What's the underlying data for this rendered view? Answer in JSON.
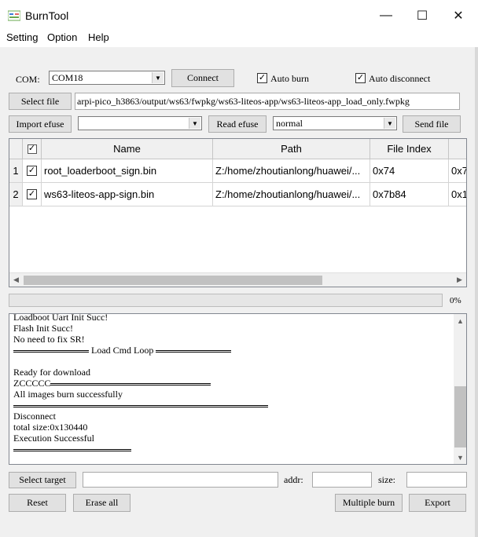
{
  "window": {
    "title": "BurnTool",
    "min_glyph": "—",
    "max_glyph": "☐",
    "close_glyph": "✕"
  },
  "menu": [
    "Setting",
    "Option",
    "Help"
  ],
  "connection": {
    "com_label": "COM:",
    "com_value": "COM18",
    "connect_label": "Connect",
    "auto_burn_label": "Auto burn",
    "auto_burn_checked": true,
    "auto_disconnect_label": "Auto disconnect",
    "auto_disconnect_checked": true
  },
  "file": {
    "select_label": "Select file",
    "path": "arpi-pico_h3863/output/ws63/fwpkg/ws63-liteos-app/ws63-liteos-app_load_only.fwpkg"
  },
  "efuse": {
    "import_label": "Import efuse",
    "import_value": "",
    "read_label": "Read efuse",
    "mode_value": "normal",
    "send_label": "Send file"
  },
  "table": {
    "columns": [
      "",
      "Name",
      "Path",
      "File Index",
      ""
    ],
    "rows": [
      {
        "num": "1",
        "checked": true,
        "name": "root_loaderboot_sign.bin",
        "path": "Z:/home/zhoutianlong/huawei/...",
        "index": "0x74",
        "extra": "0x7"
      },
      {
        "num": "2",
        "checked": true,
        "name": "ws63-liteos-app-sign.bin",
        "path": "Z:/home/zhoutianlong/huawei/...",
        "index": "0x7b84",
        "extra": "0x1"
      }
    ]
  },
  "progress": {
    "value": 0,
    "text": "0%"
  },
  "log": [
    {
      "text": "Loadboot Uart Init Succ!",
      "sep_before": 0,
      "sep_after": 0
    },
    {
      "text": "Flash Init Succ!",
      "sep_before": 0,
      "sep_after": 0
    },
    {
      "text": "No need to fix SR!",
      "sep_before": 0,
      "sep_after": 0
    },
    {
      "text": " Load Cmd Loop ",
      "sep_before": 1,
      "sep_after": 1
    },
    {
      "text": "",
      "sep_before": 0,
      "sep_after": 0
    },
    {
      "text": "Ready for download",
      "sep_before": 0,
      "sep_after": 0
    },
    {
      "text": "ZCCCCC",
      "sep_before": 0,
      "sep_after": 1
    },
    {
      "text": "All images burn successfully",
      "sep_before": 0,
      "sep_after": 0
    },
    {
      "text": "",
      "sep_before": 0,
      "sep_after": 0,
      "full_sep": true
    },
    {
      "text": "Disconnect",
      "sep_before": 0,
      "sep_after": 0
    },
    {
      "text": "total size:0x130440",
      "sep_before": 0,
      "sep_after": 0
    },
    {
      "text": "Execution Successful",
      "sep_before": 0,
      "sep_after": 0
    },
    {
      "text": "",
      "sep_before": 0,
      "sep_after": 0,
      "short_sep": true
    }
  ],
  "target": {
    "select_label": "Select target",
    "target_value": "",
    "addr_label": "addr:",
    "addr_value": "",
    "size_label": "size:",
    "size_value": ""
  },
  "actions": {
    "reset_label": "Reset",
    "erase_label": "Erase all",
    "multiple_label": "Multiple burn",
    "export_label": "Export"
  },
  "icons": {
    "app": "burntool-app-icon",
    "check": "✓",
    "arrow_down": "▼",
    "arrow_left": "◀",
    "arrow_right": "▶",
    "arrow_up": "▲"
  },
  "colors": {
    "progress": "#06b025",
    "background": "#f0f0f0"
  }
}
